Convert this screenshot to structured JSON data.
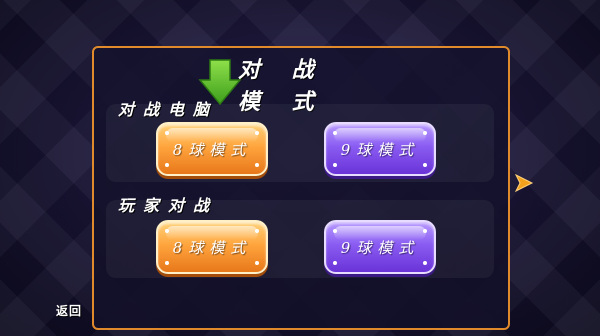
{
  "title": "对 战 模 式",
  "sections": [
    {
      "label": "对战电脑",
      "buttons": [
        {
          "label": "8球模式",
          "color": "orange"
        },
        {
          "label": "9球模式",
          "color": "purple"
        }
      ]
    },
    {
      "label": "玩家对战",
      "buttons": [
        {
          "label": "8球模式",
          "color": "orange"
        },
        {
          "label": "9球模式",
          "color": "purple"
        }
      ]
    }
  ],
  "back_label": "返回",
  "icons": {
    "hint": "down-arrow-icon",
    "next": "next-arrow-icon"
  },
  "colors": {
    "frame": "#e08a2c",
    "orange_button": "#ffa53e",
    "purple_button": "#8a5cf2",
    "hint_arrow": "#5cc22a",
    "next_arrow": "#f2a11c"
  }
}
